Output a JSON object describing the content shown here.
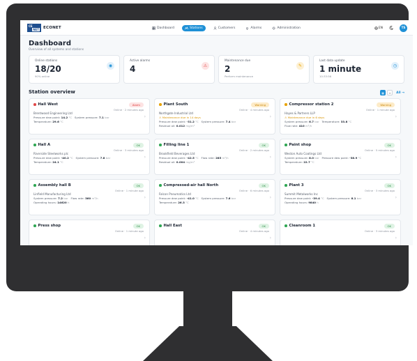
{
  "app": {
    "logo_mark_top": "CE",
    "logo_mark_bottom": "NET",
    "name": "ECONET"
  },
  "nav": {
    "items": [
      {
        "label": "Dashboard",
        "icon": "dashboard-icon"
      },
      {
        "label": "Stations",
        "icon": "stations-icon",
        "active": true
      },
      {
        "label": "Customers",
        "icon": "customers-icon"
      },
      {
        "label": "Alarms",
        "icon": "bell-icon"
      },
      {
        "label": "Administration",
        "icon": "gear-icon"
      }
    ],
    "language": "EN",
    "user_initials": "TS"
  },
  "page": {
    "title": "Dashboard",
    "subtitle": "Overview of all systems and stations"
  },
  "stats": [
    {
      "label": "Online stations",
      "value": "18/20",
      "sub": "90% online",
      "color": "#1e90d6"
    },
    {
      "label": "Active alarms",
      "value": "4",
      "sub": "",
      "color": "#e04848"
    },
    {
      "label": "Maintenance due",
      "value": "2",
      "sub": "Perform maintenance",
      "color": "#e8a200"
    },
    {
      "label": "Last data update",
      "value": "1 minute",
      "sub": "10:33:56",
      "color": "#1e90d6"
    }
  ],
  "section": {
    "title": "Station overview",
    "all_label": "All →"
  },
  "colors": {
    "accent": "#1e90d6",
    "alarm": "#e04848",
    "warning": "#e8a200",
    "ok": "#2fa653"
  },
  "stations": [
    {
      "name": "Hall West",
      "status": "Alarm",
      "kind": "alarm",
      "online": "Online · 2 minutes ago",
      "customer": "Brentwood Engineering Ltd",
      "warning": "",
      "m1": [
        "Pressure dew point:",
        "14.2",
        "°C"
      ],
      "m2": [
        "System pressure:",
        "7.1",
        "bar"
      ],
      "m3": [
        "Temperature:",
        "29.6",
        "°C"
      ]
    },
    {
      "name": "Plant South",
      "status": "Warning",
      "kind": "warning",
      "online": "Online · 4 minutes ago",
      "customer": "Northgate Industrial Ltd",
      "warning": "⚠ Maintenance due in 14 days",
      "m1": [
        "Pressure dew point:",
        "-31.2",
        "°C"
      ],
      "m2": [
        "System pressure:",
        "7.4",
        "bar"
      ],
      "m3": [
        "Residual oil:",
        "0.012",
        "mg/m³"
      ]
    },
    {
      "name": "Compressor station 2",
      "status": "Warning",
      "kind": "warning",
      "online": "Online · 1 minute ago",
      "customer": "Hayes & Partners LLP",
      "warning": "⚠ Maintenance due in 6 days",
      "m1": [
        "System pressure:",
        "6.7",
        "bar"
      ],
      "m2": [
        "Temperature:",
        "33.8",
        "°C"
      ],
      "m3": [
        "Flow rate:",
        "410",
        "m³/h"
      ]
    },
    {
      "name": "Hall A",
      "status": "OK",
      "kind": "ok",
      "online": "Online · 3 minutes ago",
      "customer": "Riverside Steelworks plc",
      "warning": "",
      "m1": [
        "Pressure dew point:",
        "-40.2",
        "°C"
      ],
      "m2": [
        "System pressure:",
        "7.8",
        "bar"
      ],
      "m3": [
        "Temperature:",
        "24.1",
        "°C"
      ]
    },
    {
      "name": "Filling line 1",
      "status": "OK",
      "kind": "ok",
      "online": "Online · 2 minutes ago",
      "customer": "Brookfield Beverages Ltd",
      "warning": "",
      "m1": [
        "Pressure dew point:",
        "-42.5",
        "°C"
      ],
      "m2": [
        "Flow rate:",
        "285",
        "m³/h"
      ],
      "m3": [
        "Residual oil:",
        "0.004",
        "mg/m³"
      ]
    },
    {
      "name": "Paint shop",
      "status": "OK",
      "kind": "ok",
      "online": "Online · 5 minutes ago",
      "customer": "Weston Auto Coatings Ltd",
      "warning": "",
      "m1": [
        "System pressure:",
        "8.0",
        "bar"
      ],
      "m2": [
        "Pressure dew point:",
        "-38.9",
        "°C"
      ],
      "m3": [
        "Temperature:",
        "22.7",
        "°C"
      ]
    },
    {
      "name": "Assembly hall B",
      "status": "OK",
      "kind": "ok",
      "online": "Online · 1 minute ago",
      "customer": "Linfield Manufacturing Ltd",
      "warning": "",
      "m1": [
        "System pressure:",
        "7.2",
        "bar"
      ],
      "m2": [
        "Flow rate:",
        "360",
        "m³/h"
      ],
      "m3": [
        "Operating hours:",
        "14620",
        "h"
      ]
    },
    {
      "name": "Compressed-air hall North",
      "status": "OK",
      "kind": "ok",
      "online": "Online · 6 minutes ago",
      "customer": "Falcon Pneumatics Ltd",
      "warning": "",
      "m1": [
        "Pressure dew point:",
        "-41.0",
        "°C"
      ],
      "m2": [
        "System pressure:",
        "7.6",
        "bar"
      ],
      "m3": [
        "Temperature:",
        "26.3",
        "°C"
      ]
    },
    {
      "name": "Plant 3",
      "status": "OK",
      "kind": "ok",
      "online": "Online · 3 minutes ago",
      "customer": "Summit Metalworks Inc",
      "warning": "",
      "m1": [
        "Pressure dew point:",
        "-39.4",
        "°C"
      ],
      "m2": [
        "System pressure:",
        "8.1",
        "bar"
      ],
      "m3": [
        "Operating hours:",
        "9840",
        "h"
      ]
    },
    {
      "name": "Press shop",
      "status": "OK",
      "kind": "ok",
      "online": "Online · 1 minute ago",
      "customer": "",
      "warning": "",
      "m1": [
        "",
        "",
        ""
      ],
      "m2": [
        "",
        "",
        ""
      ],
      "m3": [
        "",
        "",
        ""
      ]
    },
    {
      "name": "Hall East",
      "status": "OK",
      "kind": "ok",
      "online": "Online · 4 minutes ago",
      "customer": "",
      "warning": "",
      "m1": [
        "",
        "",
        ""
      ],
      "m2": [
        "",
        "",
        ""
      ],
      "m3": [
        "",
        "",
        ""
      ]
    },
    {
      "name": "Cleanroom 1",
      "status": "OK",
      "kind": "ok",
      "online": "Online · 3 minutes ago",
      "customer": "",
      "warning": "",
      "m1": [
        "",
        "",
        ""
      ],
      "m2": [
        "",
        "",
        ""
      ],
      "m3": [
        "",
        "",
        ""
      ]
    }
  ]
}
